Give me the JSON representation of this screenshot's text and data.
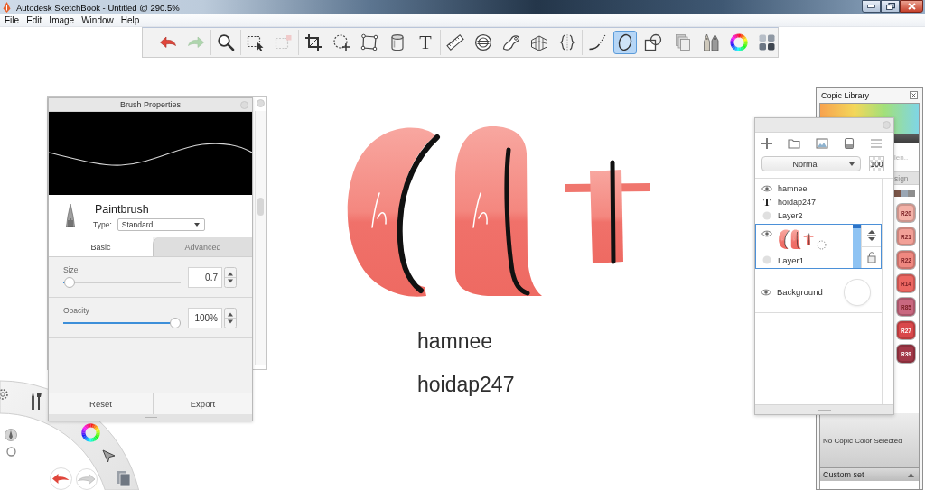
{
  "window": {
    "title": "Autodesk SketchBook - Untitled @ 290.5%"
  },
  "menu": [
    "File",
    "Edit",
    "Image",
    "Window",
    "Help"
  ],
  "toolbar": [
    [
      {
        "selected": false,
        "disabled": false
      },
      {
        "selected": false,
        "disabled": true
      }
    ],
    [
      {
        "selected": false,
        "disabled": false
      }
    ],
    [
      {
        "selected": false,
        "disabled": false
      },
      {
        "selected": false,
        "disabled": true
      }
    ],
    [
      {
        "selected": false,
        "disabled": false
      },
      {
        "selected": false,
        "disabled": false
      },
      {
        "selected": false,
        "disabled": false
      },
      {
        "selected": false,
        "disabled": false
      },
      {
        "glyph": "T",
        "selected": false,
        "disabled": false
      }
    ],
    [
      {
        "selected": false,
        "disabled": false
      },
      {
        "selected": false,
        "disabled": false
      },
      {
        "selected": false,
        "disabled": false
      },
      {
        "selected": false,
        "disabled": false
      },
      {
        "selected": false,
        "disabled": false
      }
    ],
    [
      {
        "selected": false,
        "disabled": false
      },
      {
        "selected": true,
        "disabled": false
      },
      {
        "selected": false,
        "disabled": false
      }
    ],
    [
      {
        "selected": false,
        "disabled": false
      },
      {
        "selected": false,
        "disabled": false
      },
      {
        "selected": false,
        "disabled": false
      },
      {
        "selected": false,
        "disabled": false
      }
    ]
  ],
  "canvas": {
    "texts": [
      "hamnee",
      "hoidap247"
    ]
  },
  "brush_properties": {
    "title": "Brush Properties",
    "brush": "Paintbrush",
    "type_label": "Type:",
    "type": "Standard",
    "tabs": [
      {
        "label": "Basic",
        "selected": true
      },
      {
        "label": "Advanced",
        "selected": false
      }
    ],
    "sliders": [
      {
        "label": "Size",
        "level": 0.01,
        "value": "0.7"
      },
      {
        "label": "Opacity",
        "level": 1,
        "value": "100%"
      }
    ],
    "buttons": [
      "Reset",
      "Export"
    ]
  },
  "layers": {
    "blend_mode": "Normal",
    "opacity": "100",
    "items": [
      {
        "name": "hamnee",
        "kind": "row",
        "visible": true,
        "selected": false
      },
      {
        "name": "hoidap247",
        "kind": "row",
        "glyph": "T",
        "selected": false
      },
      {
        "name": "Layer2",
        "kind": "row",
        "visible": false,
        "selected": false
      },
      {
        "name": "Layer1",
        "kind": "thumbnail",
        "visible": true,
        "selected": true
      },
      {
        "name": "Background",
        "kind": "background",
        "visible": true,
        "selected": false
      }
    ]
  },
  "copic_library": {
    "title": "Copic Library",
    "search_placeholder": "len..",
    "tab": "sign",
    "strip": [
      {
        "color": "#7a5548"
      },
      {
        "color": "#9aa6b4"
      },
      {
        "color": "#8e8e8e"
      }
    ],
    "markers": [
      {
        "code": "R20",
        "color": "#f4b2a8",
        "selected": false
      },
      {
        "code": "R21",
        "color": "#f2a097",
        "selected": false
      },
      {
        "code": "R22",
        "color": "#ef8880",
        "selected": false
      },
      {
        "code": "R14",
        "color": "#ec6762",
        "selected": false
      },
      {
        "code": "R85",
        "color": "#c96880",
        "selected": false
      },
      {
        "code": "R27",
        "color": "#d9484b",
        "selected": false
      },
      {
        "code": "R39",
        "color": "#a23848",
        "selected": false
      }
    ],
    "status": "No Copic Color Selected",
    "set": "Custom set"
  }
}
